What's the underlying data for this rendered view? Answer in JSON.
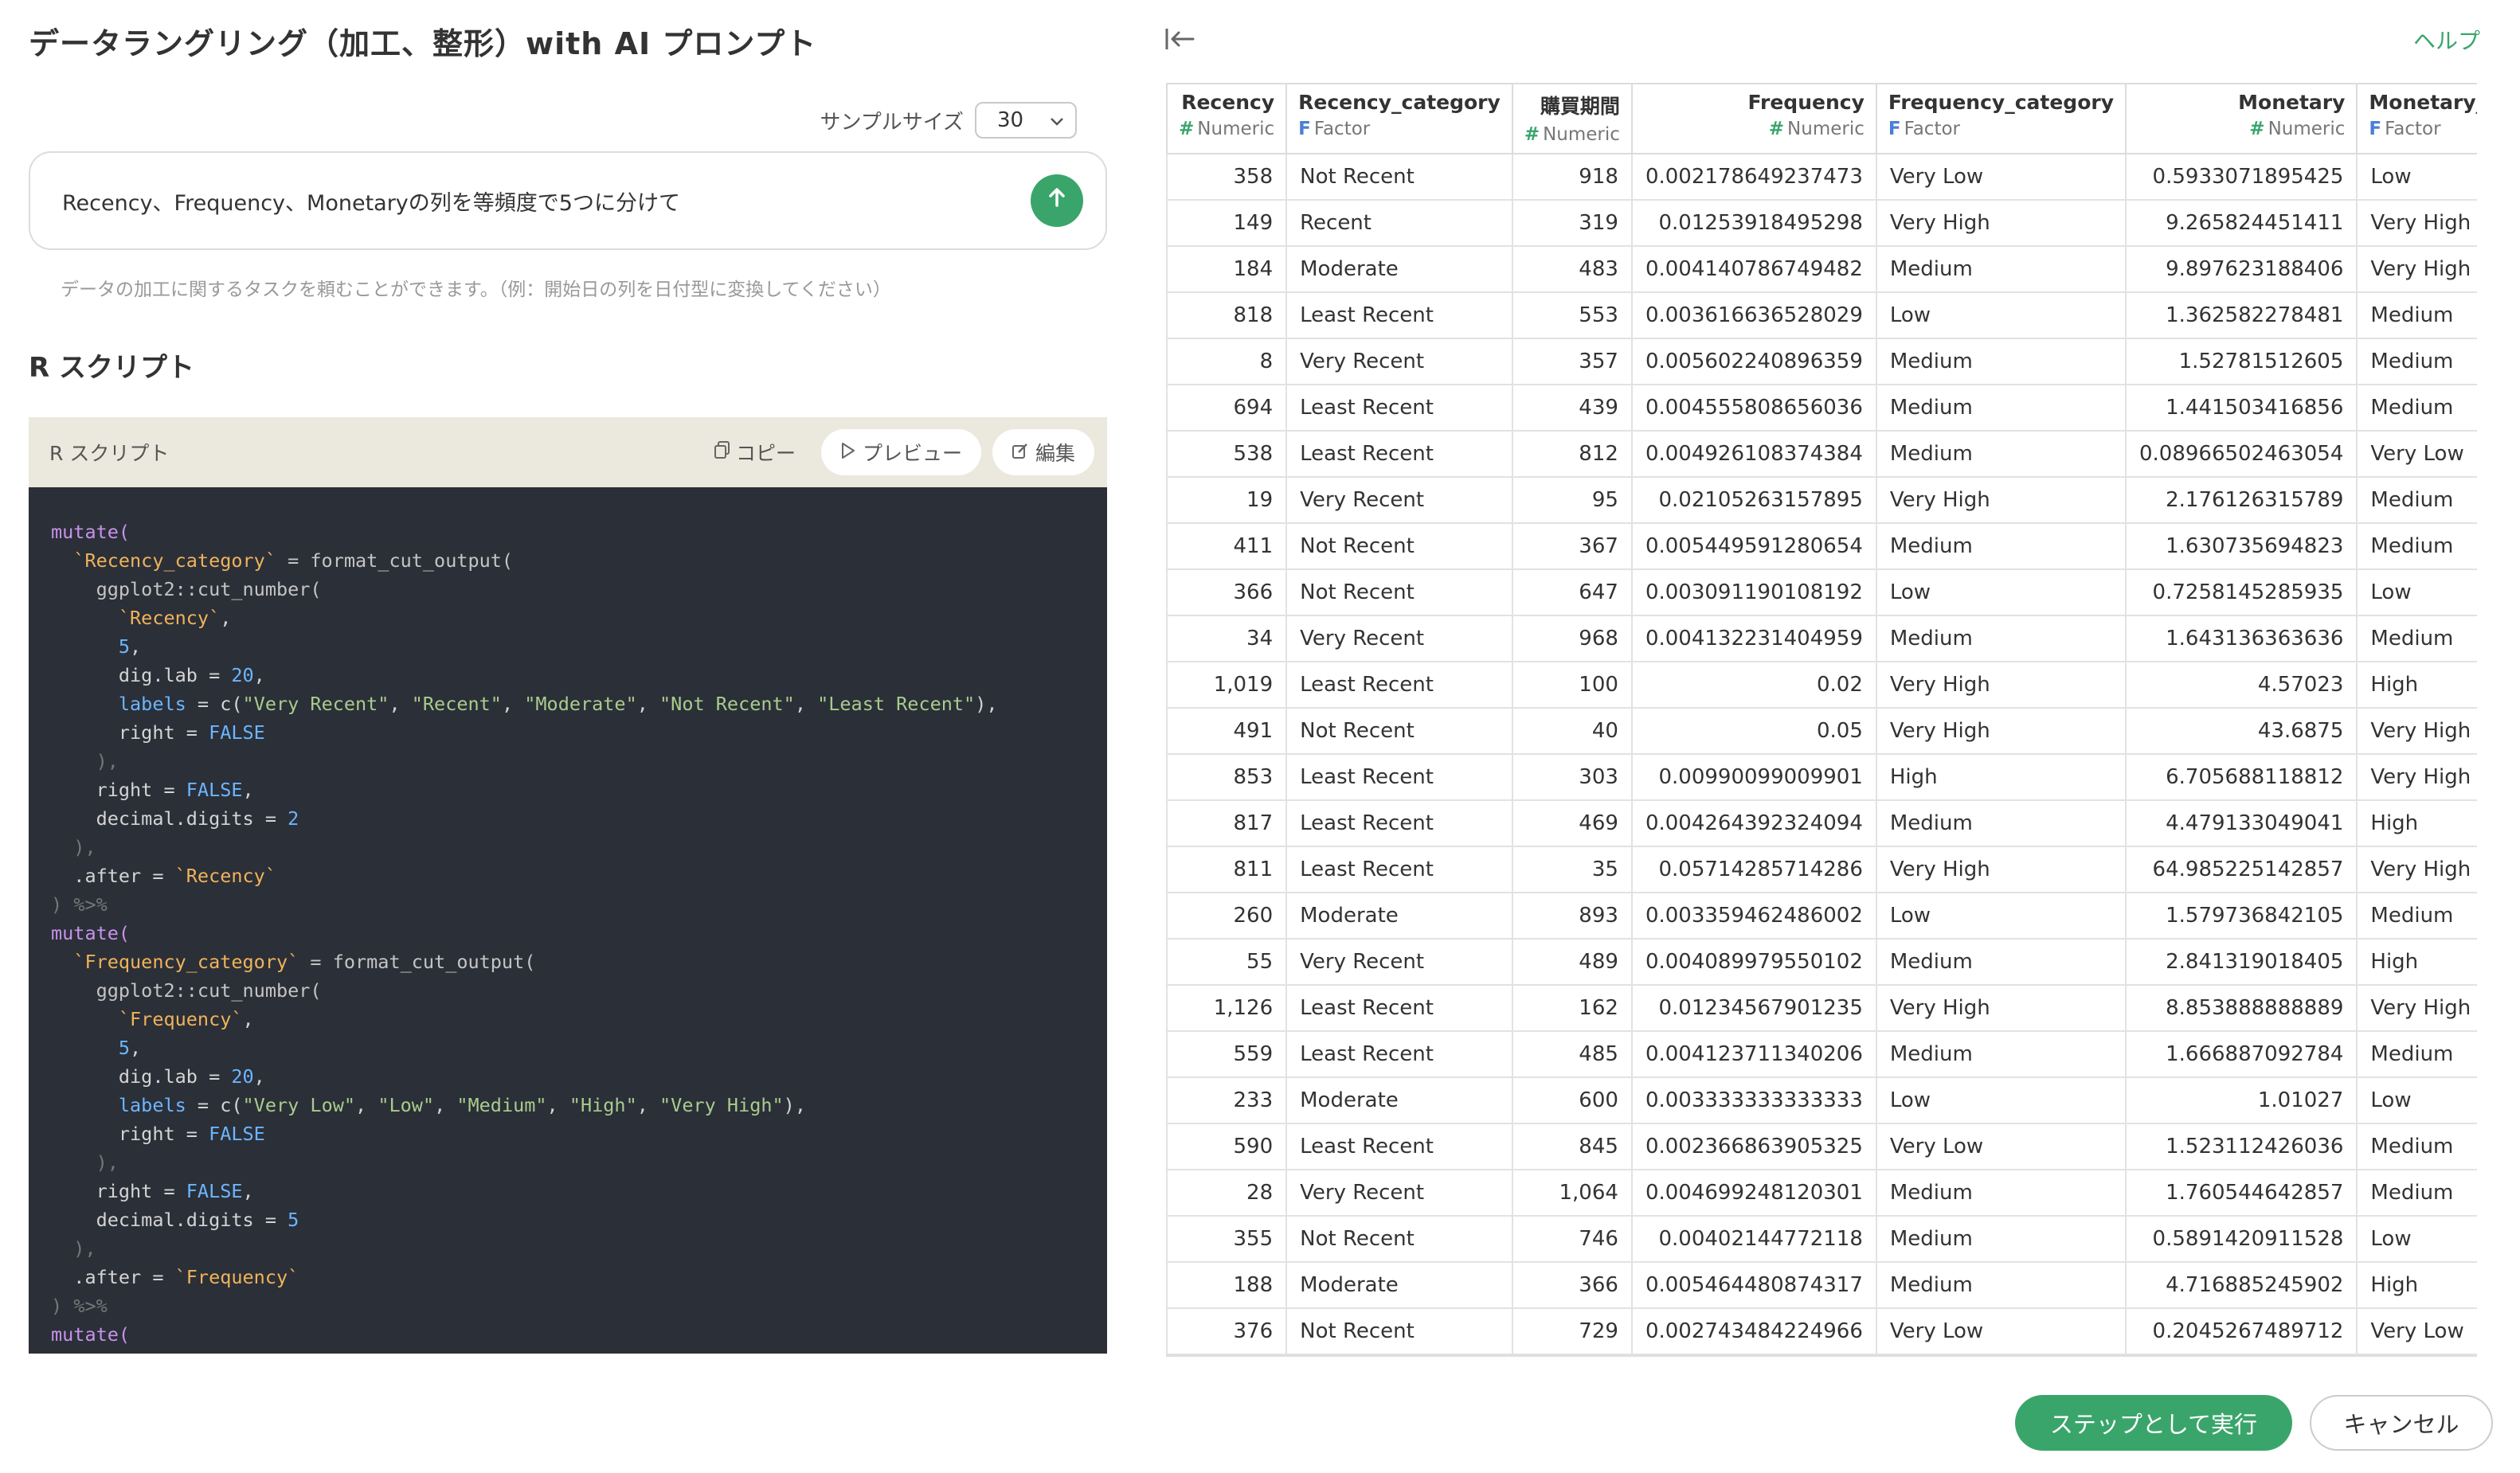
{
  "header": {
    "title": "データラングリング（加工、整形）with AI プロンプト"
  },
  "sample": {
    "label": "サンプルサイズ",
    "value": "30"
  },
  "prompt": {
    "text": "Recency、Frequency、Monetaryの列を等頻度で5つに分けて",
    "hint": "データの加工に関するタスクを頼むことができます。（例：開始日の列を日付型に変換してください）"
  },
  "script_section": {
    "heading": "R スクリプト",
    "panel_title": "R スクリプト",
    "copy_label": "コピー",
    "preview_label": "プレビュー",
    "edit_label": "編集",
    "code": {
      "mutate": "mutate(",
      "rc_col": "`Recency_category`",
      "assign_fmt": " = format_cut_output(",
      "cut": "ggplot2::cut_number(",
      "rec_col": "`Recency`",
      "five": "5",
      "diglab": "dig.lab = ",
      "twenty": "20",
      "labels_kw": "labels",
      "eq_c": " = c(",
      "rc_labels": [
        "\"Very Recent\"",
        "\"Recent\"",
        "\"Moderate\"",
        "\"Not Recent\"",
        "\"Least Recent\""
      ],
      "right_eq": "right = ",
      "false": "FALSE",
      "close": "),",
      "comma": ",",
      "close_paren_comma": "),",
      "dec_digits": "decimal.digits = ",
      "two": "2",
      "after": ".after = ",
      "pipe": "%>%",
      "close_paren": ")",
      "fc_col": "`Frequency_category`",
      "freq_col": "`Frequency`",
      "fc_labels": [
        "\"Very Low\"",
        "\"Low\"",
        "\"Medium\"",
        "\"High\"",
        "\"Very High\""
      ]
    }
  },
  "right_panel": {
    "help_label": "ヘルプ"
  },
  "table": {
    "columns": [
      {
        "name": "Recency",
        "type": "Numeric",
        "kind": "num"
      },
      {
        "name": "Recency_category",
        "type": "Factor",
        "kind": "fac"
      },
      {
        "name": "購買期間",
        "type": "Numeric",
        "kind": "num"
      },
      {
        "name": "Frequency",
        "type": "Numeric",
        "kind": "num"
      },
      {
        "name": "Frequency_category",
        "type": "Factor",
        "kind": "fac"
      },
      {
        "name": "Monetary",
        "type": "Numeric",
        "kind": "num"
      },
      {
        "name": "Monetary_category",
        "type": "Factor",
        "kind": "fac"
      }
    ],
    "rows": [
      [
        "358",
        "Not Recent",
        "918",
        "0.002178649237473",
        "Very Low",
        "0.5933071895425",
        "Low"
      ],
      [
        "149",
        "Recent",
        "319",
        "0.01253918495298",
        "Very High",
        "9.265824451411",
        "Very High"
      ],
      [
        "184",
        "Moderate",
        "483",
        "0.004140786749482",
        "Medium",
        "9.897623188406",
        "Very High"
      ],
      [
        "818",
        "Least Recent",
        "553",
        "0.003616636528029",
        "Low",
        "1.362582278481",
        "Medium"
      ],
      [
        "8",
        "Very Recent",
        "357",
        "0.005602240896359",
        "Medium",
        "1.52781512605",
        "Medium"
      ],
      [
        "694",
        "Least Recent",
        "439",
        "0.004555808656036",
        "Medium",
        "1.441503416856",
        "Medium"
      ],
      [
        "538",
        "Least Recent",
        "812",
        "0.004926108374384",
        "Medium",
        "0.08966502463054",
        "Very Low"
      ],
      [
        "19",
        "Very Recent",
        "95",
        "0.02105263157895",
        "Very High",
        "2.176126315789",
        "Medium"
      ],
      [
        "411",
        "Not Recent",
        "367",
        "0.005449591280654",
        "Medium",
        "1.630735694823",
        "Medium"
      ],
      [
        "366",
        "Not Recent",
        "647",
        "0.003091190108192",
        "Low",
        "0.7258145285935",
        "Low"
      ],
      [
        "34",
        "Very Recent",
        "968",
        "0.004132231404959",
        "Medium",
        "1.643136363636",
        "Medium"
      ],
      [
        "1,019",
        "Least Recent",
        "100",
        "0.02",
        "Very High",
        "4.57023",
        "High"
      ],
      [
        "491",
        "Not Recent",
        "40",
        "0.05",
        "Very High",
        "43.6875",
        "Very High"
      ],
      [
        "853",
        "Least Recent",
        "303",
        "0.00990099009901",
        "High",
        "6.705688118812",
        "Very High"
      ],
      [
        "817",
        "Least Recent",
        "469",
        "0.004264392324094",
        "Medium",
        "4.479133049041",
        "High"
      ],
      [
        "811",
        "Least Recent",
        "35",
        "0.05714285714286",
        "Very High",
        "64.985225142857",
        "Very High"
      ],
      [
        "260",
        "Moderate",
        "893",
        "0.003359462486002",
        "Low",
        "1.579736842105",
        "Medium"
      ],
      [
        "55",
        "Very Recent",
        "489",
        "0.004089979550102",
        "Medium",
        "2.841319018405",
        "High"
      ],
      [
        "1,126",
        "Least Recent",
        "162",
        "0.01234567901235",
        "Very High",
        "8.853888888889",
        "Very High"
      ],
      [
        "559",
        "Least Recent",
        "485",
        "0.004123711340206",
        "Medium",
        "1.666887092784",
        "Medium"
      ],
      [
        "233",
        "Moderate",
        "600",
        "0.003333333333333",
        "Low",
        "1.01027",
        "Low"
      ],
      [
        "590",
        "Least Recent",
        "845",
        "0.002366863905325",
        "Very Low",
        "1.523112426036",
        "Medium"
      ],
      [
        "28",
        "Very Recent",
        "1,064",
        "0.004699248120301",
        "Medium",
        "1.760544642857",
        "Medium"
      ],
      [
        "355",
        "Not Recent",
        "746",
        "0.00402144772118",
        "Medium",
        "0.5891420911528",
        "Low"
      ],
      [
        "188",
        "Moderate",
        "366",
        "0.005464480874317",
        "Medium",
        "4.716885245902",
        "High"
      ],
      [
        "376",
        "Not Recent",
        "729",
        "0.002743484224966",
        "Very Low",
        "0.2045267489712",
        "Very Low"
      ]
    ]
  },
  "footer": {
    "run_label": "ステップとして実行",
    "cancel_label": "キャンセル"
  }
}
